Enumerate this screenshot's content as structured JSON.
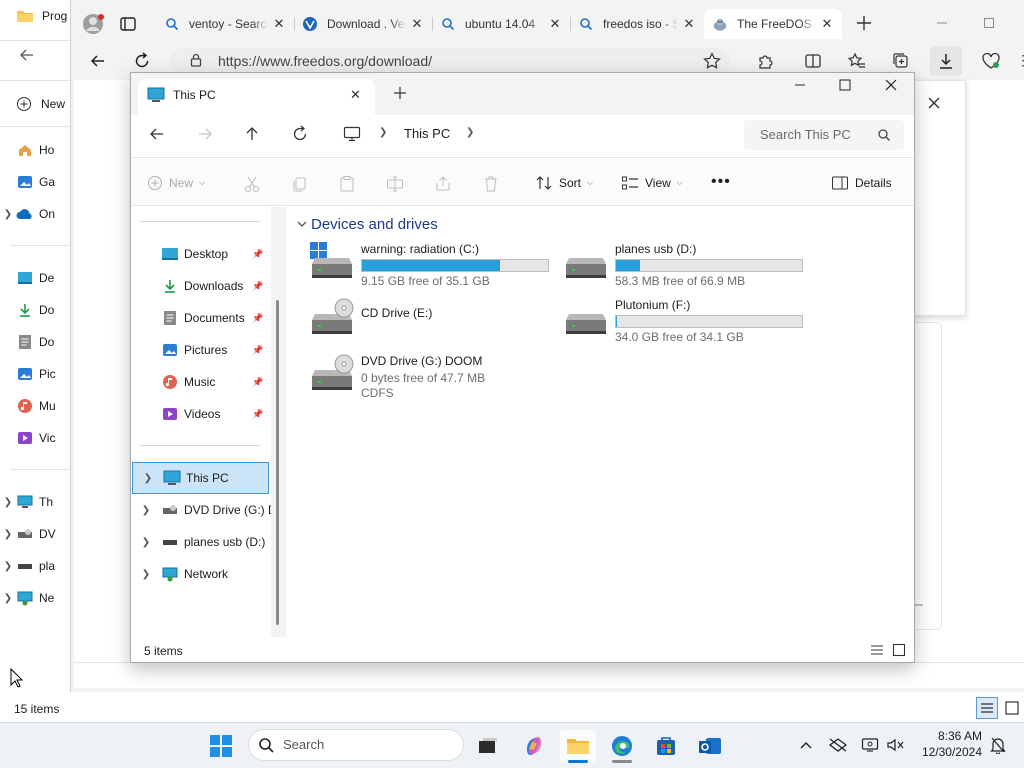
{
  "background_explorer": {
    "title": "Prog",
    "new_label": "New",
    "items": [
      {
        "label": "Ho",
        "icon": "home-icon"
      },
      {
        "label": "Ga",
        "icon": "gallery-icon"
      },
      {
        "label": "On",
        "icon": "onedrive-icon"
      },
      {
        "label": "De",
        "icon": "desktop-icon"
      },
      {
        "label": "Do",
        "icon": "downloads-icon"
      },
      {
        "label": "Do",
        "icon": "documents-icon"
      },
      {
        "label": "Pic",
        "icon": "pictures-icon"
      },
      {
        "label": "Mu",
        "icon": "music-icon"
      },
      {
        "label": "Vic",
        "icon": "videos-icon"
      },
      {
        "label": "Th",
        "icon": "this-pc-icon"
      },
      {
        "label": "DV",
        "icon": "dvd-drive-icon"
      },
      {
        "label": "pla",
        "icon": "usb-drive-icon"
      },
      {
        "label": "Ne",
        "icon": "network-icon"
      }
    ],
    "status": "15 items"
  },
  "browser": {
    "tabs": [
      {
        "label": "ventoy - Search",
        "icon": "search-tab-icon"
      },
      {
        "label": "Download . Ventoy",
        "icon": "ventoy-icon"
      },
      {
        "label": "ubuntu 14.04",
        "icon": "search-tab-icon"
      },
      {
        "label": "freedos iso - Search",
        "icon": "search-tab-icon"
      },
      {
        "label": "The FreeDOS Project",
        "icon": "freedos-icon"
      }
    ],
    "url": "https://www.freedos.org/download/"
  },
  "explorer": {
    "tab_title": "This PC",
    "breadcrumb": "This PC",
    "search_placeholder": "Search This PC",
    "toolbar": {
      "new": "New",
      "sort": "Sort",
      "view": "View",
      "details": "Details"
    },
    "nav": {
      "quick_access": [
        {
          "label": "Desktop",
          "icon": "desktop-icon"
        },
        {
          "label": "Downloads",
          "icon": "downloads-icon"
        },
        {
          "label": "Documents",
          "icon": "documents-icon"
        },
        {
          "label": "Pictures",
          "icon": "pictures-icon"
        },
        {
          "label": "Music",
          "icon": "music-icon"
        },
        {
          "label": "Videos",
          "icon": "videos-icon"
        }
      ],
      "locations": [
        {
          "label": "This PC",
          "icon": "this-pc-icon"
        },
        {
          "label": "DVD Drive (G:) DOOM",
          "icon": "dvd-drive-icon"
        },
        {
          "label": "planes usb (D:)",
          "icon": "usb-drive-icon"
        },
        {
          "label": "Network",
          "icon": "network-icon"
        }
      ]
    },
    "section_title": "Devices and drives",
    "drives": [
      {
        "name": "warning: radiation (C:)",
        "free": "9.15 GB free of 35.1 GB",
        "used_fraction": 0.74,
        "icon": "windows-drive-icon"
      },
      {
        "name": "planes usb (D:)",
        "free": "58.3 MB free of 66.9 MB",
        "used_fraction": 0.13,
        "icon": "usb-drive-icon"
      },
      {
        "name": "CD Drive (E:)",
        "icon": "cd-drive-icon"
      },
      {
        "name": "Plutonium (F:)",
        "free": "34.0 GB free of 34.1 GB",
        "used_fraction": 0.003,
        "icon": "hard-drive-icon"
      },
      {
        "name": "DVD Drive (G:) DOOM",
        "free": "0 bytes free of 47.7 MB",
        "filesystem": "CDFS",
        "icon": "dvd-drive-icon"
      }
    ],
    "status": "5 items"
  },
  "taskbar": {
    "search": "Search",
    "time": "8:36 AM",
    "date": "12/30/2024"
  },
  "colors": {
    "accent": "#0078d4",
    "drive_bar_fill": "#26a0da",
    "selection_bg": "#cce4f7",
    "section_title": "#1e3a8a"
  }
}
